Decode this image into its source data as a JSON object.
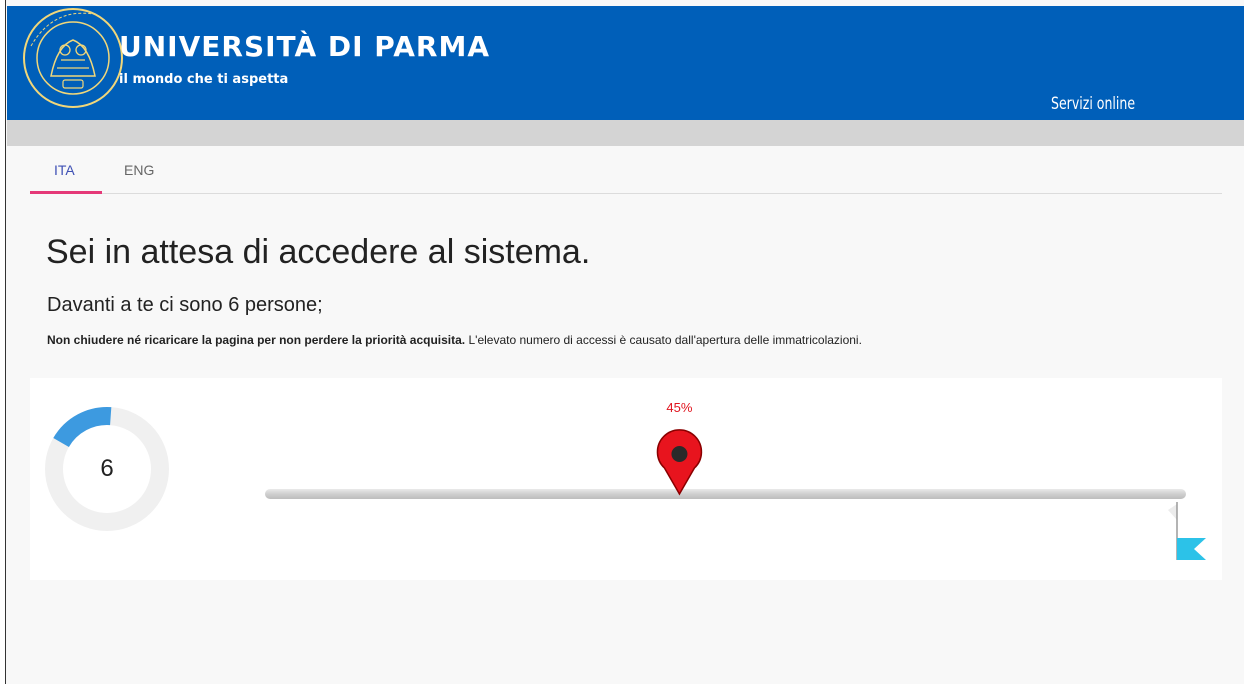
{
  "header": {
    "logo_text": "UNIVERSITÀ DI PARMA",
    "tagline": "il mondo che ti aspetta",
    "services_link": "Servizi online",
    "seal_text": "ALMA UNIVERSITAS · STUDIORUM · PARMENSIS",
    "brand_color": "#005fb9"
  },
  "language_tabs": [
    {
      "label": "ITA",
      "active": true
    },
    {
      "label": "ENG",
      "active": false
    }
  ],
  "main": {
    "title": "Sei in attesa di accedere al sistema.",
    "queue_text": "Davanti a te ci sono 6 persone;",
    "warning_bold": "Non chiudere né ricaricare la pagina per non perdere la priorità acquisita.",
    "warning_rest": " L'elevato numero di accessi è causato dall'apertura delle immatricolazioni."
  },
  "progress": {
    "people_ahead": "6",
    "percent_label": "45%",
    "percent": 45,
    "pin_color": "#e8141e",
    "donut_color": "#3d9ae0",
    "flag_color": "#2cc2e8",
    "icons": [
      "map-pin-icon",
      "finish-flag-icon"
    ]
  }
}
